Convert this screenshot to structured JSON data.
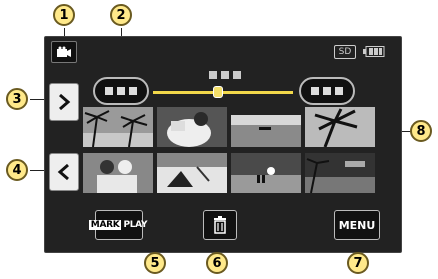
{
  "callouts": [
    "1",
    "2",
    "3",
    "4",
    "5",
    "6",
    "7",
    "8"
  ],
  "screen": {
    "sd_label": "SD",
    "mode_icon": "video-camera-icon",
    "battery_icon": "battery-icon",
    "nav_next_icon": "chevron-right-icon",
    "nav_prev_icon": "chevron-left-icon",
    "delete_icon": "trash-icon",
    "markplay_label_a": "MARK",
    "markplay_label_b": "PLAY",
    "menu_label": "MENU"
  },
  "accent_color": "#f2d84a"
}
